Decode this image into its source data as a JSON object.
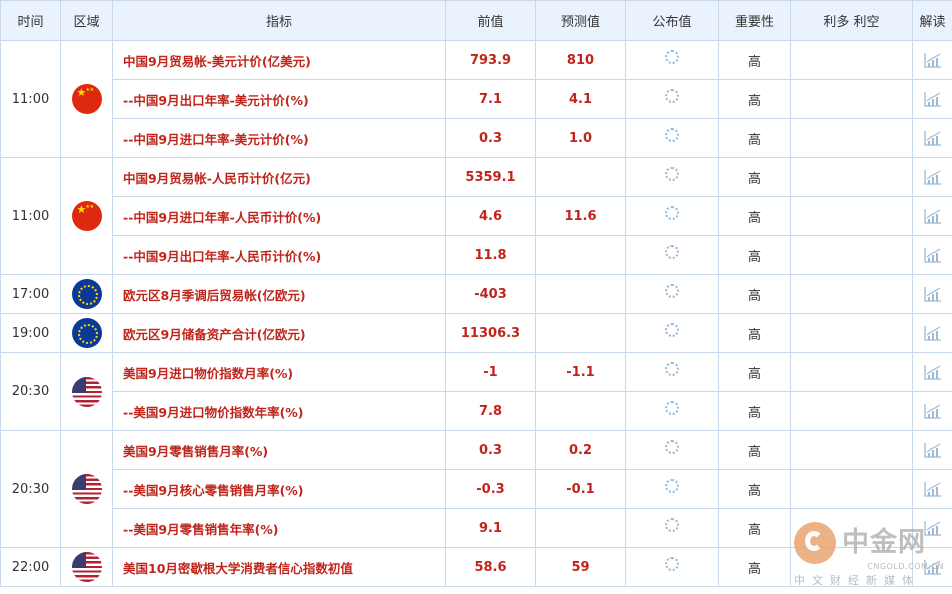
{
  "headers": {
    "time": "时间",
    "region": "区域",
    "indicator": "指标",
    "previous": "前值",
    "forecast": "预测值",
    "actual": "公布值",
    "importance": "重要性",
    "impact": "利多 利空",
    "analysis": "解读"
  },
  "icons": {
    "loading": "loading-spinner-icon",
    "analysis": "line-chart-icon",
    "flags": {
      "cn": "china-flag-icon",
      "eu": "eu-flag-icon",
      "us": "usa-flag-icon"
    }
  },
  "colors": {
    "indicator_text": "#c0251b",
    "header_bg": "#eaf3fd",
    "border": "#c9d9ea",
    "analysis_icon": "#9fb9d3"
  },
  "groups": [
    {
      "time": "11:00",
      "flag": "cn",
      "rows": [
        {
          "indicator": "中国9月贸易帐-美元计价(亿美元)",
          "previous": "793.9",
          "forecast": "810",
          "actual": "",
          "importance": "高"
        },
        {
          "indicator": "--中国9月出口年率-美元计价(%)",
          "previous": "7.1",
          "forecast": "4.1",
          "actual": "",
          "importance": "高"
        },
        {
          "indicator": "--中国9月进口年率-美元计价(%)",
          "previous": "0.3",
          "forecast": "1.0",
          "actual": "",
          "importance": "高"
        }
      ]
    },
    {
      "time": "11:00",
      "flag": "cn",
      "rows": [
        {
          "indicator": "中国9月贸易帐-人民币计价(亿元)",
          "previous": "5359.1",
          "forecast": "",
          "actual": "",
          "importance": "高"
        },
        {
          "indicator": "--中国9月进口年率-人民币计价(%)",
          "previous": "4.6",
          "forecast": "11.6",
          "actual": "",
          "importance": "高"
        },
        {
          "indicator": "--中国9月出口年率-人民币计价(%)",
          "previous": "11.8",
          "forecast": "",
          "actual": "",
          "importance": "高"
        }
      ]
    },
    {
      "time": "17:00",
      "flag": "eu",
      "rows": [
        {
          "indicator": "欧元区8月季调后贸易帐(亿欧元)",
          "previous": "-403",
          "forecast": "",
          "actual": "",
          "importance": "高"
        }
      ]
    },
    {
      "time": "19:00",
      "flag": "eu",
      "rows": [
        {
          "indicator": "欧元区9月储备资产合计(亿欧元)",
          "previous": "11306.3",
          "forecast": "",
          "actual": "",
          "importance": "高"
        }
      ]
    },
    {
      "time": "20:30",
      "flag": "us",
      "rows": [
        {
          "indicator": "美国9月进口物价指数月率(%)",
          "previous": "-1",
          "forecast": "-1.1",
          "actual": "",
          "importance": "高"
        },
        {
          "indicator": "--美国9月进口物价指数年率(%)",
          "previous": "7.8",
          "forecast": "",
          "actual": "",
          "importance": "高"
        }
      ]
    },
    {
      "time": "20:30",
      "flag": "us",
      "rows": [
        {
          "indicator": "美国9月零售销售月率(%)",
          "previous": "0.3",
          "forecast": "0.2",
          "actual": "",
          "importance": "高"
        },
        {
          "indicator": "--美国9月核心零售销售月率(%)",
          "previous": "-0.3",
          "forecast": "-0.1",
          "actual": "",
          "importance": "高"
        },
        {
          "indicator": "--美国9月零售销售年率(%)",
          "previous": "9.1",
          "forecast": "",
          "actual": "",
          "importance": "高"
        }
      ]
    },
    {
      "time": "22:00",
      "flag": "us",
      "rows": [
        {
          "indicator": "美国10月密歇根大学消费者信心指数初值",
          "previous": "58.6",
          "forecast": "59",
          "actual": "",
          "importance": "高"
        }
      ]
    }
  ],
  "watermark": {
    "title": "中金网",
    "site": "CNGOLD.COM.CN",
    "subtitle": "中文财经新媒体"
  }
}
